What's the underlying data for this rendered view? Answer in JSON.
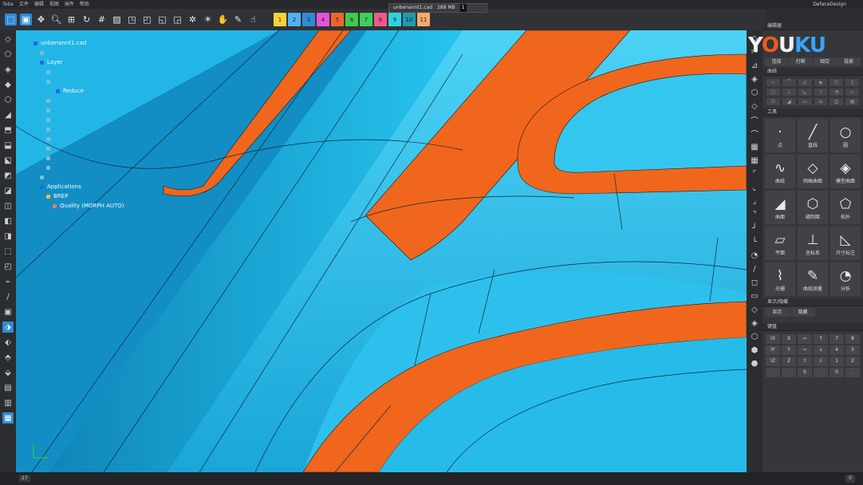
{
  "menubar": {
    "items": [
      "Teba",
      "文件",
      "编辑",
      "视图",
      "插件",
      "帮助"
    ],
    "brand": "DefaceDesign"
  },
  "document_tab": {
    "title": "unbenannt1.cad",
    "size": "288 MB",
    "badge": "1"
  },
  "layers": [
    {
      "label": "1",
      "color": "#f7d23a"
    },
    {
      "label": "2",
      "color": "#4fb1f0"
    },
    {
      "label": "3",
      "color": "#2f8bd6"
    },
    {
      "label": "4",
      "color": "#e453d8"
    },
    {
      "label": "5",
      "color": "#f2652a"
    },
    {
      "label": "6",
      "color": "#43c94c"
    },
    {
      "label": "7",
      "color": "#3bd05e"
    },
    {
      "label": "8",
      "color": "#f05a8a"
    },
    {
      "label": "9",
      "color": "#2fd4e0"
    },
    {
      "label": "10",
      "color": "#1e9bb0"
    },
    {
      "label": "11",
      "color": "#f7a86a"
    }
  ],
  "toolbar_icons": [
    "select-icon",
    "document-icon",
    "pan-icon",
    "zoom-icon",
    "fit-icon",
    "rotate-icon",
    "grid-icon",
    "image-icon",
    "view-front-icon",
    "view-top-icon",
    "view-side-icon",
    "view-iso-icon",
    "render-icon",
    "light-icon",
    "pick-icon",
    "paint-icon",
    "hand-icon"
  ],
  "tree": {
    "root": "unbenannt1.cad",
    "layers_label": "Layer",
    "reduce": "Reduce",
    "applications": "Applications",
    "brep": "BREP",
    "quality": "Quality (MORPH AUTO)"
  },
  "watermark": {
    "y": "Y",
    "o": "O",
    "u": "U",
    "k": "K",
    "u2": "U"
  },
  "panel": {
    "edit_header": "编辑器",
    "edit_buttons": [
      "连接",
      "打断",
      "相交",
      "投影"
    ],
    "curves_header": "曲线",
    "tools_header": "工具",
    "tools": [
      {
        "label": "点",
        "glyph": "·",
        "name": "point-icon"
      },
      {
        "label": "直线",
        "glyph": "╱",
        "name": "line-icon"
      },
      {
        "label": "圆",
        "glyph": "○",
        "name": "circle-icon"
      },
      {
        "label": "曲线",
        "glyph": "∿",
        "name": "curve-icon"
      },
      {
        "label": "网格曲面",
        "glyph": "◇",
        "name": "mesh-surface-icon"
      },
      {
        "label": "模型曲面",
        "glyph": "◈",
        "name": "model-surface-icon"
      },
      {
        "label": "曲面",
        "glyph": "◢",
        "name": "surface-icon"
      },
      {
        "label": "缝制面",
        "glyph": "⬡",
        "name": "stitch-surface-icon"
      },
      {
        "label": "拓扑",
        "glyph": "⬠",
        "name": "topology-icon"
      },
      {
        "label": "平面",
        "glyph": "▱",
        "name": "plane-icon"
      },
      {
        "label": "坐标系",
        "glyph": "⊥",
        "name": "coordinate-system-icon"
      },
      {
        "label": "尺寸标注",
        "glyph": "◺",
        "name": "dimension-icon"
      },
      {
        "label": "光栅",
        "glyph": "⌇",
        "name": "raster-icon"
      },
      {
        "label": "曲线测量",
        "glyph": "✎",
        "name": "curve-measure-icon"
      },
      {
        "label": "分析",
        "glyph": "◔",
        "name": "analysis-icon"
      }
    ],
    "display_header": "显示/隐藏",
    "display_buttons": [
      "显示",
      "隐藏"
    ],
    "keypad_header": "键盘",
    "keypad": [
      "IX",
      "X",
      "⇦",
      "↑",
      "7",
      "8",
      "IY",
      "Y",
      "⇨",
      "↓",
      "4",
      "5",
      "IZ",
      "Z",
      "⇧",
      "⇩",
      "1",
      "2",
      "",
      "",
      "⚲",
      "",
      "0",
      "."
    ]
  },
  "status": {
    "left": "27",
    "right": "0"
  }
}
